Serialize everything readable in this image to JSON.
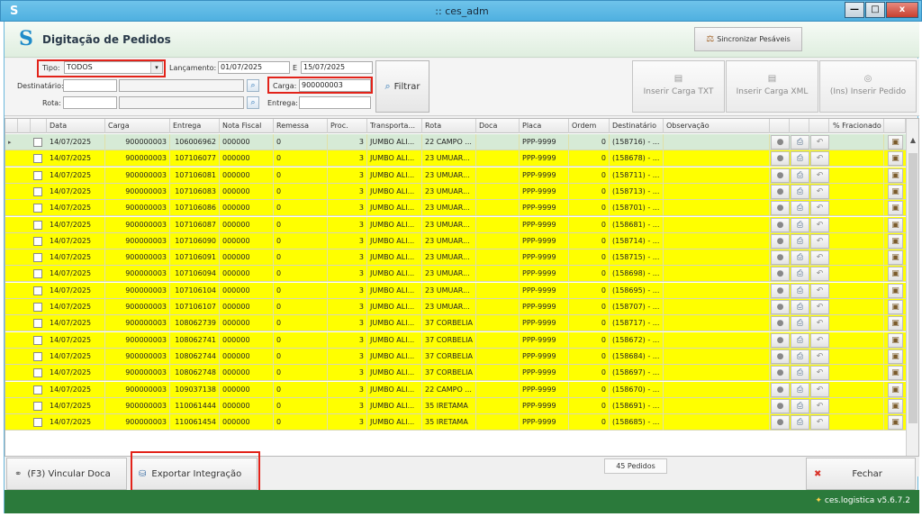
{
  "window": {
    "title": ":: ces_adm",
    "app_icon": "S",
    "min_glyph": "—",
    "max_glyph": "□",
    "close_glyph": "x"
  },
  "header": {
    "logo_glyph": "S",
    "title": "Digitação de Pedidos",
    "sync_label": "Sincronizar Pesáveis"
  },
  "filters": {
    "tipo_label": "Tipo:",
    "tipo_value": "TODOS",
    "lancamento_label": "Lançamento:",
    "lancamento_from": "01/07/2025",
    "e_label": "E",
    "lancamento_to": "15/07/2025",
    "destinatario_label": "Destinatário:",
    "destinatario_value": "",
    "destinatario_name": "",
    "rota_label": "Rota:",
    "rota_value": "",
    "rota_name": "",
    "carga_label": "Carga:",
    "carga_value": "900000003",
    "entrega_label": "Entrega:",
    "entrega_value": "",
    "filtrar_label": "Filtrar",
    "inserir_carga_txt": "Inserir Carga TXT",
    "inserir_carga_xml": "Inserir Carga XML",
    "inserir_pedido": "(Ins) Inserir Pedido"
  },
  "grid": {
    "columns": [
      "Data",
      "Carga",
      "Entrega",
      "Nota Fiscal",
      "Remessa",
      "Proc.",
      "Transporta...",
      "Rota",
      "Doca",
      "Placa",
      "Ordem",
      "Destinatário",
      "Observação",
      "% Fracionado"
    ],
    "rows": [
      [
        "14/07/2025",
        "900000003",
        "106006962",
        "000000",
        "0",
        "3",
        "JUMBO ALI...",
        "22 CAMPO ...",
        "",
        "PPP-9999",
        "0",
        "(158716) - ..."
      ],
      [
        "14/07/2025",
        "900000003",
        "107106077",
        "000000",
        "0",
        "3",
        "JUMBO ALI...",
        "23 UMUAR...",
        "",
        "PPP-9999",
        "0",
        "(158678) - ..."
      ],
      [
        "14/07/2025",
        "900000003",
        "107106081",
        "000000",
        "0",
        "3",
        "JUMBO ALI...",
        "23 UMUAR...",
        "",
        "PPP-9999",
        "0",
        "(158711) - ..."
      ],
      [
        "14/07/2025",
        "900000003",
        "107106083",
        "000000",
        "0",
        "3",
        "JUMBO ALI...",
        "23 UMUAR...",
        "",
        "PPP-9999",
        "0",
        "(158713) - ..."
      ],
      [
        "14/07/2025",
        "900000003",
        "107106086",
        "000000",
        "0",
        "3",
        "JUMBO ALI...",
        "23 UMUAR...",
        "",
        "PPP-9999",
        "0",
        "(158701) - ..."
      ],
      [
        "14/07/2025",
        "900000003",
        "107106087",
        "000000",
        "0",
        "3",
        "JUMBO ALI...",
        "23 UMUAR...",
        "",
        "PPP-9999",
        "0",
        "(158681) - ..."
      ],
      [
        "14/07/2025",
        "900000003",
        "107106090",
        "000000",
        "0",
        "3",
        "JUMBO ALI...",
        "23 UMUAR...",
        "",
        "PPP-9999",
        "0",
        "(158714) - ..."
      ],
      [
        "14/07/2025",
        "900000003",
        "107106091",
        "000000",
        "0",
        "3",
        "JUMBO ALI...",
        "23 UMUAR...",
        "",
        "PPP-9999",
        "0",
        "(158715) - ..."
      ],
      [
        "14/07/2025",
        "900000003",
        "107106094",
        "000000",
        "0",
        "3",
        "JUMBO ALI...",
        "23 UMUAR...",
        "",
        "PPP-9999",
        "0",
        "(158698) - ..."
      ],
      [
        "14/07/2025",
        "900000003",
        "107106104",
        "000000",
        "0",
        "3",
        "JUMBO ALI...",
        "23 UMUAR...",
        "",
        "PPP-9999",
        "0",
        "(158695) - ..."
      ],
      [
        "14/07/2025",
        "900000003",
        "107106107",
        "000000",
        "0",
        "3",
        "JUMBO ALI...",
        "23 UMUAR...",
        "",
        "PPP-9999",
        "0",
        "(158707) - ..."
      ],
      [
        "14/07/2025",
        "900000003",
        "108062739",
        "000000",
        "0",
        "3",
        "JUMBO ALI...",
        "37 CORBELIA",
        "",
        "PPP-9999",
        "0",
        "(158717) - ..."
      ],
      [
        "14/07/2025",
        "900000003",
        "108062741",
        "000000",
        "0",
        "3",
        "JUMBO ALI...",
        "37 CORBELIA",
        "",
        "PPP-9999",
        "0",
        "(158672) - ..."
      ],
      [
        "14/07/2025",
        "900000003",
        "108062744",
        "000000",
        "0",
        "3",
        "JUMBO ALI...",
        "37 CORBELIA",
        "",
        "PPP-9999",
        "0",
        "(158684) - ..."
      ],
      [
        "14/07/2025",
        "900000003",
        "108062748",
        "000000",
        "0",
        "3",
        "JUMBO ALI...",
        "37 CORBELIA",
        "",
        "PPP-9999",
        "0",
        "(158697) - ..."
      ],
      [
        "14/07/2025",
        "900000003",
        "109037138",
        "000000",
        "0",
        "3",
        "JUMBO ALI...",
        "22 CAMPO ...",
        "",
        "PPP-9999",
        "0",
        "(158670) - ..."
      ],
      [
        "14/07/2025",
        "900000003",
        "110061444",
        "000000",
        "0",
        "3",
        "JUMBO ALI...",
        "35 IRETAMA",
        "",
        "PPP-9999",
        "0",
        "(158691) - ..."
      ],
      [
        "14/07/2025",
        "900000003",
        "110061454",
        "000000",
        "0",
        "3",
        "JUMBO ALI...",
        "35 IRETAMA",
        "",
        "PPP-9999",
        "0",
        "(158685) - ..."
      ]
    ],
    "row_colors": {
      "selected": "#d6ead6",
      "highlight": "#ffff00"
    },
    "row_indicator": "▸",
    "icons": [
      "circle-icon",
      "printer-icon",
      "undo-icon",
      "clipboard-icon"
    ]
  },
  "footer": {
    "count_label": "45 Pedidos",
    "vincular_label": "(F3) Vincular Doca",
    "exportar_label": "Exportar Integração",
    "fechar_label": "Fechar",
    "version": "ces.logistica v5.6.7.2"
  },
  "colors": {
    "status_bar": "#2b7a3b",
    "title_bar": "#4fb0e0",
    "annotation_red": "#e2231a"
  }
}
